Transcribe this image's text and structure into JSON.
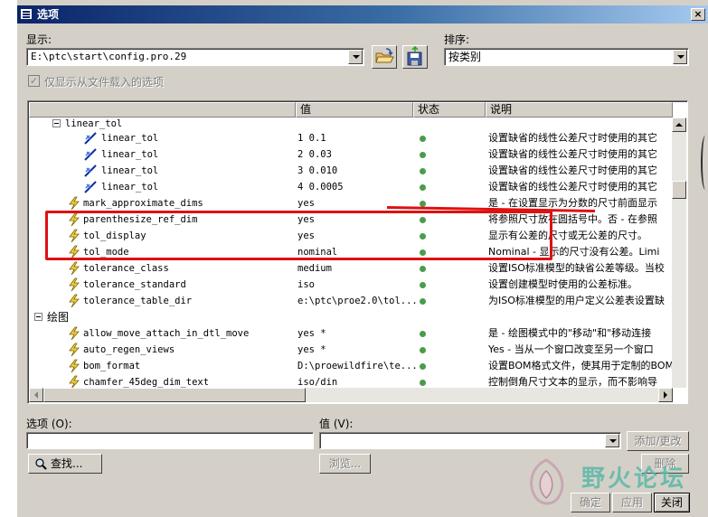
{
  "window": {
    "title": "选项",
    "close": "×"
  },
  "display": {
    "label": "显示:",
    "value": "E:\\ptc\\start\\config.pro.29"
  },
  "sort": {
    "label": "排序:",
    "value": "按类别"
  },
  "only_file_loaded_checkbox": {
    "label": "仅显示从文件载入的选项",
    "checked": true
  },
  "grid": {
    "headers": [
      "",
      "值",
      "状态",
      "说明"
    ],
    "rows": [
      {
        "name": "linear_tol",
        "value": "",
        "desc": "",
        "type": "group"
      },
      {
        "name": "linear_tol",
        "value": "1 0.1",
        "desc": "设置缺省的线性公差尺寸时使用的其它",
        "type": "item"
      },
      {
        "name": "linear_tol",
        "value": "2 0.03",
        "desc": "设置缺省的线性公差尺寸时使用的其它",
        "type": "item"
      },
      {
        "name": "linear_tol",
        "value": "3 0.010",
        "desc": "设置缺省的线性公差尺寸时使用的其它",
        "type": "item"
      },
      {
        "name": "linear_tol",
        "value": "4 0.0005",
        "desc": "设置缺省的线性公差尺寸时使用的其它",
        "type": "item"
      },
      {
        "name": "mark_approximate_dims",
        "value": "yes",
        "desc": "是 - 在设置显示为分数的尺寸前面显示",
        "type": "option"
      },
      {
        "name": "parenthesize_ref_dim",
        "value": "yes",
        "desc": "将参照尺寸放在圆括号中。否 - 在参照",
        "type": "option"
      },
      {
        "name": "tol_display",
        "value": "yes",
        "desc": "显示有公差的尺寸或无公差的尺寸。",
        "type": "option"
      },
      {
        "name": "tol_mode",
        "value": "nominal",
        "desc": "Nominal - 显示的尺寸没有公差。Limi",
        "type": "option"
      },
      {
        "name": "tolerance_class",
        "value": "medium",
        "desc": "设置ISO标准模型的缺省公差等级。当校",
        "type": "option"
      },
      {
        "name": "tolerance_standard",
        "value": "iso",
        "desc": "设置创建模型时使用的公差标准。",
        "type": "option"
      },
      {
        "name": "tolerance_table_dir",
        "value": "e:\\ptc\\proe2.0\\tol...",
        "desc": "为ISO标准模型的用户定义公差表设置缺",
        "type": "option"
      },
      {
        "name": "绘图",
        "value": "",
        "desc": "",
        "type": "category"
      },
      {
        "name": "allow_move_attach_in_dtl_move",
        "value": "yes *",
        "desc": "是 - 绘图模式中的\"移动\"和\"移动连接",
        "type": "option"
      },
      {
        "name": "auto_regen_views",
        "value": "yes *",
        "desc": "Yes - 当从一个窗口改变至另一个窗口",
        "type": "option"
      },
      {
        "name": "bom_format",
        "value": "D:\\proewildfire\\te...",
        "desc": "设置BOM格式文件，使其用于定制的BOM",
        "type": "option"
      },
      {
        "name": "chamfer_45deg_dim_text",
        "value": "iso/din",
        "desc": "控制倒角尺寸文本的显示，而不影响导",
        "type": "option"
      }
    ]
  },
  "option_field": {
    "label": "选项 (O):",
    "value": ""
  },
  "value_field": {
    "label": "值 (V):",
    "value": ""
  },
  "buttons": {
    "add_change": "添加/更改",
    "find": "查找...",
    "browse": "浏览...",
    "delete": "删除",
    "ok": "确定",
    "apply": "应用",
    "close": "关闭"
  },
  "watermark": {
    "text": "野火论坛"
  },
  "colors": {
    "titlebar_start": "#0a246a",
    "titlebar_end": "#a6caf0",
    "dialog_face": "#d4d0c8",
    "status_ok": "#4b9b4b",
    "highlight": "#e01010"
  }
}
